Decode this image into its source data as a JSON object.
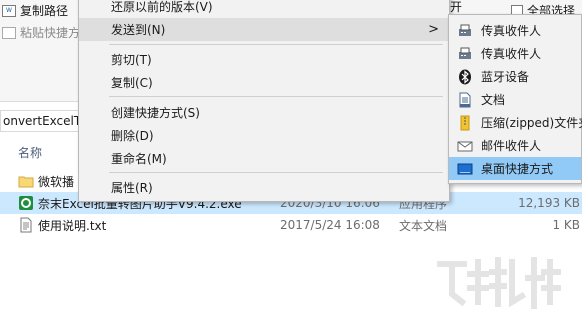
{
  "ribbon": {
    "copy_path": "复制路径",
    "paste_shortcut": "粘贴快捷方",
    "select_all": "全部选择",
    "restore_label": "还原以前的版本(V)"
  },
  "address": {
    "text": "onvertExcelTo"
  },
  "columns": {
    "name": "名称"
  },
  "files": [
    {
      "name": "微软播",
      "date": "",
      "type": "",
      "size": "",
      "icon": "folder-icon"
    },
    {
      "name": "奈末Excel批量转图片助手V9.4.2.exe",
      "date": "2020/3/10 16:06",
      "type": "应用程序",
      "size": "12,193 KB",
      "icon": "app-icon"
    },
    {
      "name": "使用说明.txt",
      "date": "2017/5/24 16:08",
      "type": "文本文档",
      "size": "1 KB",
      "icon": "text-file-icon"
    }
  ],
  "context_menu": {
    "send_to": "发送到(N)",
    "cut": "剪切(T)",
    "copy": "复制(C)",
    "create_shortcut": "创建快捷方式(S)",
    "delete": "删除(D)",
    "rename": "重命名(M)",
    "properties": "属性(R)",
    "submenu_arrow": ">"
  },
  "send_to_menu": [
    {
      "label": "传真收件人",
      "icon": "fax-icon"
    },
    {
      "label": "传真收件人",
      "icon": "fax-icon"
    },
    {
      "label": "蓝牙设备",
      "icon": "bluetooth-icon"
    },
    {
      "label": "文档",
      "icon": "documents-icon"
    },
    {
      "label": "压缩(zipped)文件夹",
      "icon": "zip-folder-icon"
    },
    {
      "label": "邮件收件人",
      "icon": "mail-icon"
    },
    {
      "label": "桌面快捷方式",
      "icon": "desktop-icon"
    }
  ],
  "colors": {
    "selected_row": "#cce8ff",
    "submenu_hover": "#91c9f7",
    "menu_bg": "#f2f2f2"
  }
}
